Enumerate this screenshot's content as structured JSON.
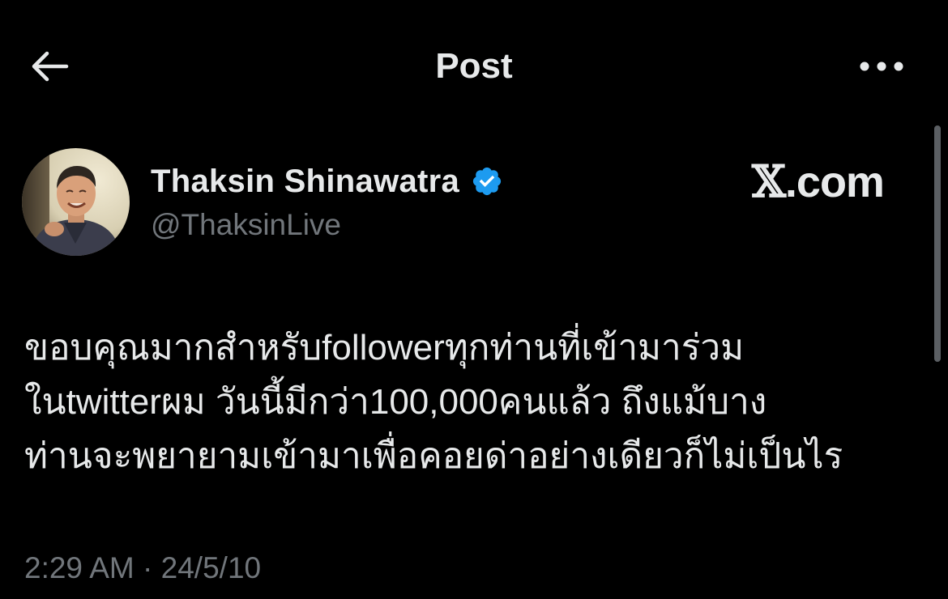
{
  "header": {
    "back_icon": "arrow-left-icon",
    "title": "Post",
    "more_icon": "more-horizontal-icon"
  },
  "author": {
    "display_name": "Thaksin Shinawatra",
    "handle": "@ThaksinLive",
    "verified": true,
    "verified_badge_color": "#1d9bf0",
    "avatar_icon": "avatar-photo"
  },
  "watermark": {
    "x_mark": "𝕏",
    "domain": ".com"
  },
  "tweet": {
    "lines": [
      "ขอบคุณมากสำหรับfollowerทุกท่านที่เข้ามาร่วม",
      "ในtwitterผม วันนี้มีกว่า100,000คนแล้ว ถึงแม้บาง",
      "ท่านจะพยายามเข้ามาเพื่อคอยด่าอย่างเดียวก็ไม่เป็นไร"
    ],
    "time": "2:29 AM",
    "separator": "·",
    "date": "24/5/10"
  },
  "colors": {
    "background": "#000000",
    "primary_text": "#e7e9ea",
    "secondary_text": "#71767b",
    "accent": "#1d9bf0"
  }
}
